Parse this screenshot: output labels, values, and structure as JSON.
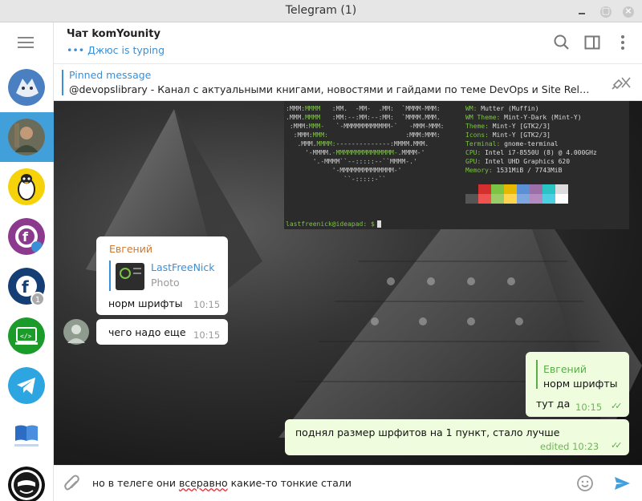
{
  "window": {
    "title": "Telegram (1)"
  },
  "sidebar": {
    "chats": [
      {
        "icon": "wolf-avatar"
      },
      {
        "icon": "photo-avatar",
        "active": true
      },
      {
        "icon": "linux-tux-avatar"
      },
      {
        "icon": "fedora-avatar"
      },
      {
        "icon": "fedora-blue-avatar",
        "badge": "1"
      },
      {
        "icon": "terminal-avatar"
      },
      {
        "icon": "telegram-avatar"
      },
      {
        "icon": "book-logo-avatar"
      },
      {
        "icon": "masked-avatar"
      }
    ]
  },
  "header": {
    "name": "Чат komYounity",
    "status": "Джюс is typing"
  },
  "pinned": {
    "title": "Pinned message",
    "text": "@devopslibrary - Канал с актуальными книгами, новостями и гайдами по теме DevOps и Site Reliabilit..."
  },
  "terminal": {
    "info": [
      {
        "k": "WM:",
        "v": " Mutter (Muffin)"
      },
      {
        "k": "WM Theme:",
        "v": " Mint-Y-Dark (Mint-Y)"
      },
      {
        "k": "Theme:",
        "v": " Mint-Y [GTK2/3]"
      },
      {
        "k": "Icons:",
        "v": " Mint-Y [GTK2/3]"
      },
      {
        "k": "Terminal:",
        "v": " gnome-terminal"
      },
      {
        "k": "CPU:",
        "v": " Intel i7-8550U (8) @ 4.000GHz"
      },
      {
        "k": "GPU:",
        "v": " Intel UHD Graphics 620"
      },
      {
        "k": "Memory:",
        "v": " 1531MiB / 7743MiB"
      }
    ],
    "prompt": "lastfreenick@ideapad: $",
    "palette": [
      "#2b2b2b",
      "#d32f2f",
      "#7cc443",
      "#e6b800",
      "#5b8fd6",
      "#9b6fa8",
      "#2bc4c4",
      "#dcdcdc",
      "#555555",
      "#ef5350",
      "#9ccc65",
      "#ffd54f",
      "#7ea7e0",
      "#b38bbf",
      "#4dd0e1",
      "#ffffff"
    ]
  },
  "messages": {
    "m1": {
      "sender": "Евгений",
      "reply_name": "LastFreeNick",
      "reply_type": "Photo",
      "text": "норм шрифты",
      "time": "10:15"
    },
    "m2": {
      "text": "чего надо еще",
      "time": "10:15"
    },
    "m3": {
      "reply_name": "Евгений",
      "reply_text": "норм шрифты",
      "text": "тут да",
      "time": "10:15"
    },
    "m4": {
      "text": "поднял размер шрфитов на 1 пункт, стало лучше",
      "time": "edited 10:23"
    }
  },
  "composer": {
    "text_before": "но в телеге они ",
    "text_misspelled": "всеравно",
    "text_after": " какие-то тонкие стали"
  },
  "colors": {
    "accent": "#419fd9",
    "outgoing_bubble": "#effdde",
    "sender_name": "#d3762b",
    "read_ticks": "#5cab4b"
  }
}
